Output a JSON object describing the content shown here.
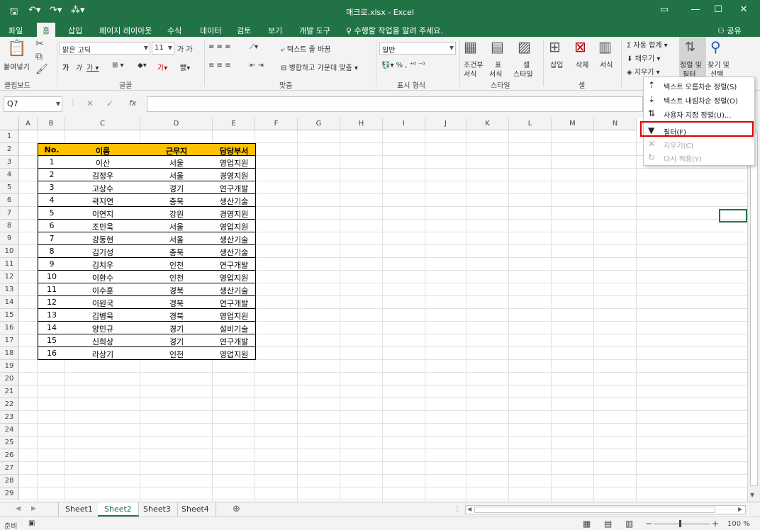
{
  "titlebar": {
    "title": "매크로.xlsx - Excel",
    "save_icon": "save-icon",
    "undo_icon": "undo-icon",
    "redo_icon": "redo-icon",
    "accent": "#217346"
  },
  "tabs": [
    "파일",
    "홈",
    "삽입",
    "페이지 레이아웃",
    "수식",
    "데이터",
    "검토",
    "보기",
    "개발 도구"
  ],
  "tell_me": "수행할 작업을 알려 주세요.",
  "share": "공유",
  "ribbon": {
    "paste": "붙여넣기",
    "clipboard": "클립보드",
    "font_name": "맑은 고딕",
    "font_size": "11",
    "font_group": "글꼴",
    "wrap_text": "텍스트 줄 바꿈",
    "merge_center": "병합하고 가운데 맞춤",
    "align_group": "맞춤",
    "number_format": "일반",
    "number_group": "표시 형식",
    "cond_format": "조건부",
    "cond_format2": "서식",
    "table_format": "표",
    "table_format2": "서식",
    "cell_style": "셀",
    "cell_style2": "스타일",
    "style_group": "스타일",
    "insert": "삽입",
    "delete": "삭제",
    "format": "서식",
    "cells_group": "셀",
    "autosum": "자동 합계",
    "fill": "채우기",
    "clear": "지우기",
    "sort_filter": "정렬 및",
    "sort_filter2": "필터",
    "find_select": "찾기 및",
    "find_select2": "선택"
  },
  "namebox": "Q7",
  "columns": [
    "A",
    "B",
    "C",
    "D",
    "E",
    "F",
    "G",
    "H",
    "I",
    "J",
    "K",
    "L",
    "M",
    "N"
  ],
  "rows": [
    "1",
    "2",
    "3",
    "4",
    "5",
    "6",
    "7",
    "8",
    "9",
    "10",
    "11",
    "12",
    "13",
    "14",
    "15",
    "16",
    "17",
    "18",
    "19",
    "20",
    "21",
    "22",
    "23",
    "24",
    "25",
    "26",
    "27",
    "28",
    "29"
  ],
  "table": {
    "headers": [
      "No.",
      "이름",
      "근무지",
      "담당부서"
    ],
    "header_color": "#ffc000",
    "rows": [
      [
        "1",
        "이산",
        "서울",
        "영업지원"
      ],
      [
        "2",
        "김정우",
        "서울",
        "경영지원"
      ],
      [
        "3",
        "고상수",
        "경기",
        "연구개발"
      ],
      [
        "4",
        "곽지연",
        "충북",
        "생산기술"
      ],
      [
        "5",
        "이연지",
        "강원",
        "경영지원"
      ],
      [
        "6",
        "조민욱",
        "서울",
        "영업지원"
      ],
      [
        "7",
        "강동현",
        "서울",
        "생산기술"
      ],
      [
        "8",
        "김기성",
        "충북",
        "생산기술"
      ],
      [
        "9",
        "김치우",
        "인천",
        "연구개발"
      ],
      [
        "10",
        "이환수",
        "인천",
        "영업지원"
      ],
      [
        "11",
        "이수훈",
        "경북",
        "생산기술"
      ],
      [
        "12",
        "이원국",
        "경북",
        "연구개발"
      ],
      [
        "13",
        "김병욱",
        "경북",
        "영업지원"
      ],
      [
        "14",
        "양민규",
        "경기",
        "설비기술"
      ],
      [
        "15",
        "신희상",
        "경기",
        "연구개발"
      ],
      [
        "16",
        "라상기",
        "인천",
        "영업지원"
      ]
    ]
  },
  "sheets": [
    "Sheet1",
    "Sheet2",
    "Sheet3",
    "Sheet4"
  ],
  "active_sheet": "Sheet2",
  "status": {
    "ready": "준비",
    "zoom": "100 %"
  },
  "menu": {
    "sort_asc": "텍스트 오름차순 정렬(S)",
    "sort_desc": "텍스트 내림차순 정렬(O)",
    "custom_sort": "사용자 지정 정렬(U)...",
    "filter": "필터(F)",
    "clear": "지우기(C)",
    "reapply": "다시 적용(Y)",
    "highlight_color": "#e00000"
  }
}
